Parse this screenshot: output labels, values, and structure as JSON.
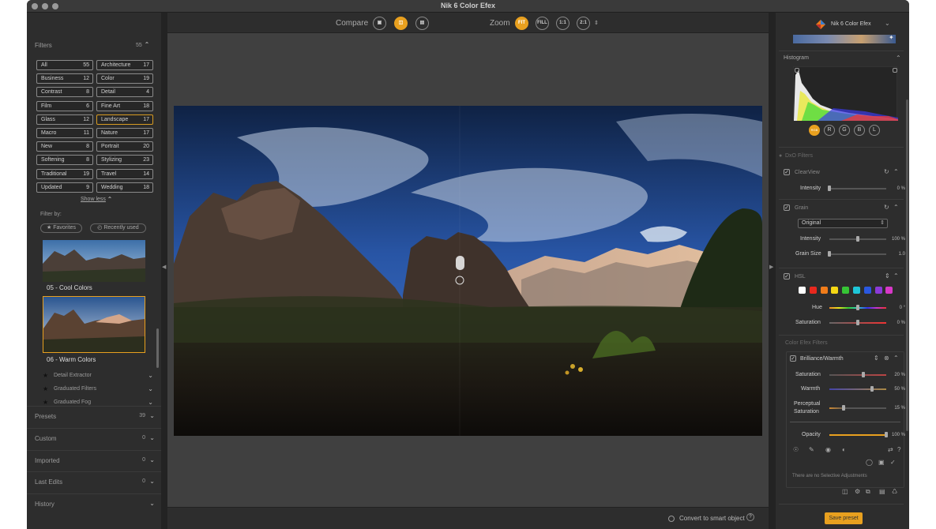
{
  "window": {
    "title": "Nik 6 Color Efex"
  },
  "left_panel": {
    "filters_header": "Filters",
    "filters_count": "55",
    "filter_buttons": [
      {
        "name": "All",
        "count": "55"
      },
      {
        "name": "Architecture",
        "count": "17"
      },
      {
        "name": "Business",
        "count": "12"
      },
      {
        "name": "Color",
        "count": "19"
      },
      {
        "name": "Contrast",
        "count": "8"
      },
      {
        "name": "Detail",
        "count": "4"
      },
      {
        "name": "Film",
        "count": "6"
      },
      {
        "name": "Fine Art",
        "count": "18"
      },
      {
        "name": "Glass",
        "count": "12"
      },
      {
        "name": "Landscape",
        "count": "17"
      },
      {
        "name": "Macro",
        "count": "11"
      },
      {
        "name": "Nature",
        "count": "17"
      },
      {
        "name": "New",
        "count": "8"
      },
      {
        "name": "Portrait",
        "count": "20"
      },
      {
        "name": "Softening",
        "count": "8"
      },
      {
        "name": "Stylizing",
        "count": "23"
      },
      {
        "name": "Traditional",
        "count": "19"
      },
      {
        "name": "Travel",
        "count": "14"
      },
      {
        "name": "Updated",
        "count": "9"
      },
      {
        "name": "Wedding",
        "count": "18"
      }
    ],
    "show_less": "Show less",
    "filter_by": "Filter by:",
    "favorites": "Favorites",
    "recently_used": "Recently used",
    "thumbnails": [
      {
        "label": "05 - Cool Colors"
      },
      {
        "label": "06 - Warm Colors"
      }
    ],
    "sub_filters": [
      "Detail Extractor",
      "Graduated Filters",
      "Graduated Fog"
    ],
    "sections": [
      {
        "title": "Presets",
        "count": "39"
      },
      {
        "title": "Custom",
        "count": "0"
      },
      {
        "title": "Imported",
        "count": "0"
      },
      {
        "title": "Last Edits",
        "count": "0"
      },
      {
        "title": "History",
        "count": ""
      }
    ]
  },
  "toolbar": {
    "compare_label": "Compare",
    "zoom_label": "Zoom",
    "zoom_buttons": [
      "FIT",
      "FILL",
      "1:1",
      "2:1"
    ]
  },
  "bottom_bar": {
    "convert_label": "Convert to smart object",
    "help": "?"
  },
  "right_panel": {
    "app_title": "Nik 6 Color Efex",
    "histogram_label": "Histogram",
    "channels": [
      "RGB",
      "R",
      "G",
      "B",
      "L"
    ],
    "dxo_filters_label": "DxO Filters",
    "clearview": {
      "title": "ClearView",
      "intensity_label": "Intensity",
      "intensity_value": "0 %",
      "intensity_level": 0.0
    },
    "grain": {
      "title": "Grain",
      "mode": "Original",
      "intensity_label": "Intensity",
      "intensity_value": "100 %",
      "intensity_level": 0.5,
      "size_label": "Grain Size",
      "size_value": "1.0",
      "size_level": 0.0
    },
    "hsl": {
      "title": "HSL",
      "hue_label": "Hue",
      "hue_value": "0 °",
      "hue_level": 0.5,
      "sat_label": "Saturation",
      "sat_value": "0 %",
      "sat_level": 0.5,
      "swatches": [
        "#ffffff",
        "#e8281e",
        "#f07c1a",
        "#f5d714",
        "#36c435",
        "#1ec6d8",
        "#2a58e0",
        "#8c3ad8",
        "#d838c8"
      ]
    },
    "color_efex_label": "Color Efex Filters",
    "brilliance": {
      "title": "Brilliance/Warmth",
      "sat_label": "Saturation",
      "sat_value": "20 %",
      "sat_level": 0.6,
      "warmth_label": "Warmth",
      "warmth_value": "50 %",
      "warmth_level": 0.75,
      "perc_label1": "Perceptual",
      "perc_label2": "Saturation",
      "perc_value": "15 %",
      "perc_level": 0.25
    },
    "opacity_label": "Opacity",
    "opacity_value": "100 %",
    "opacity_level": 1.0,
    "no_adjustments": "There are no Selective Adjustments",
    "save_preset": "Save preset"
  }
}
